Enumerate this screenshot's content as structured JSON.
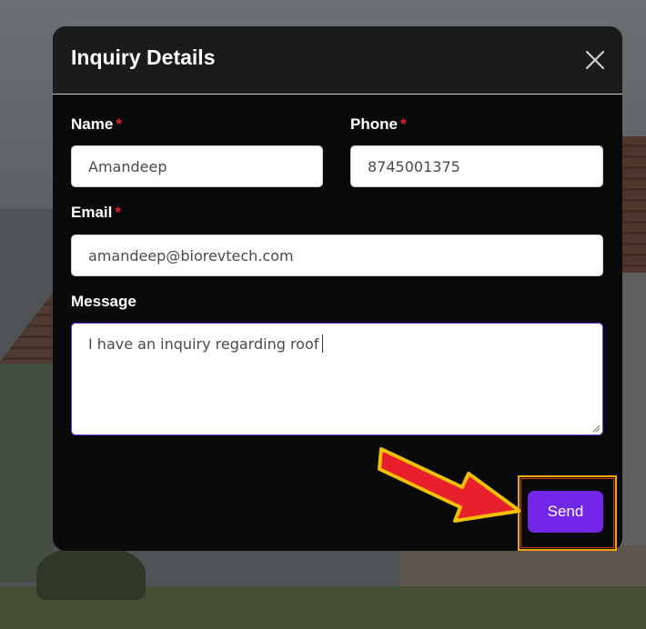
{
  "modal": {
    "title": "Inquiry Details",
    "close_icon": "close-icon"
  },
  "form": {
    "name": {
      "label": "Name",
      "required_mark": "*",
      "value": "Amandeep"
    },
    "phone": {
      "label": "Phone",
      "required_mark": "*",
      "value": "8745001375"
    },
    "email": {
      "label": "Email",
      "required_mark": "*",
      "value": "amandeep@biorevtech.com"
    },
    "message": {
      "label": "Message",
      "value": "I have an inquiry regarding roof"
    },
    "send_label": "Send"
  },
  "annotation": {
    "arrow_icon": "red-arrow-icon",
    "arrow_color": "#e8202b",
    "highlight_color": "#f5a300"
  },
  "colors": {
    "accent": "#7126e8",
    "required": "#e8202b",
    "modal_bg": "#0a0a0a"
  }
}
